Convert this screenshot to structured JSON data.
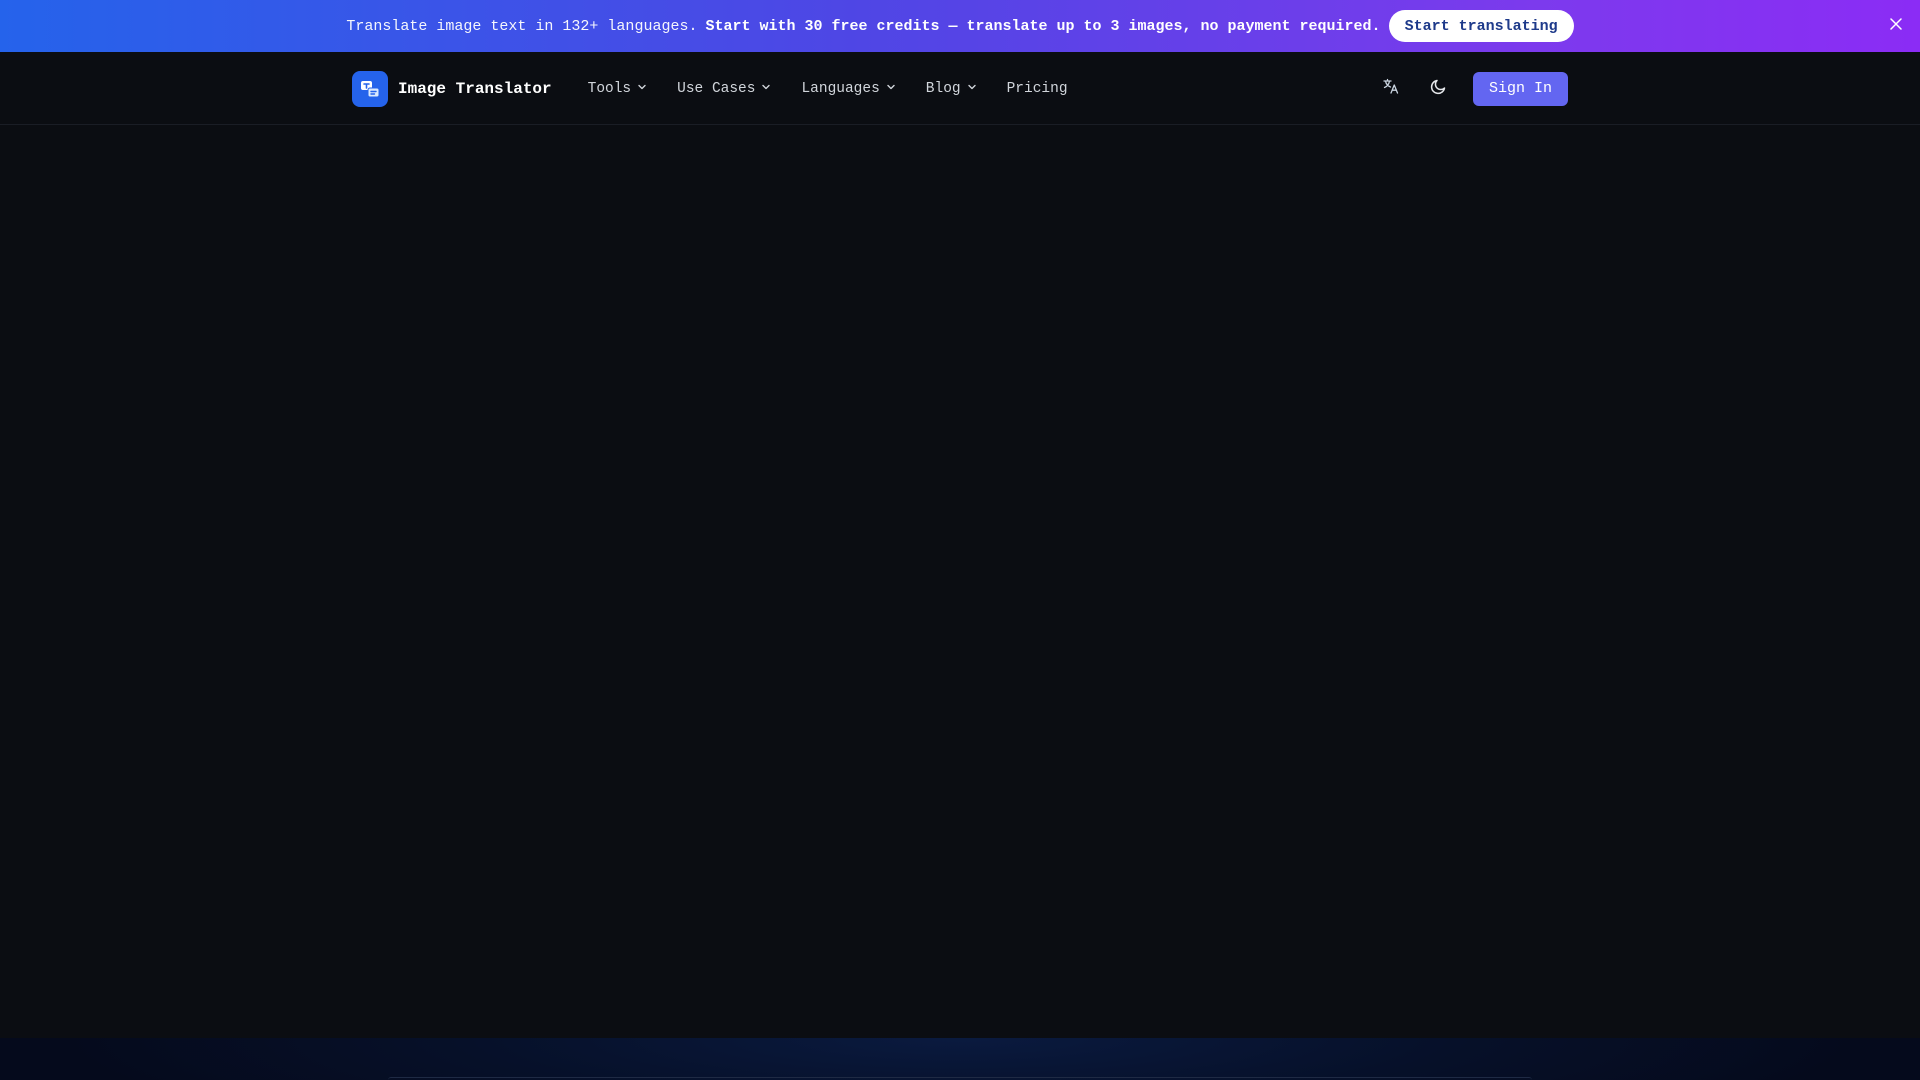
{
  "banner": {
    "text": "Translate image text in 132+ languages.",
    "bold_text": "Start with 30 free credits — translate up to 3 images, no payment required.",
    "cta_label": "Start translating",
    "close_icon": "close-icon"
  },
  "header": {
    "brand_name": "Image Translator",
    "logo_icon": "translate-logo-icon",
    "nav": [
      {
        "label": "Tools",
        "has_dropdown": true
      },
      {
        "label": "Use Cases",
        "has_dropdown": true
      },
      {
        "label": "Languages",
        "has_dropdown": true
      },
      {
        "label": "Blog",
        "has_dropdown": true
      },
      {
        "label": "Pricing",
        "has_dropdown": false
      }
    ],
    "language_icon": "language-icon",
    "theme_icon": "moon-icon",
    "signin_label": "Sign In"
  },
  "colors": {
    "banner_start": "#2563eb",
    "banner_end": "#8b2cf5",
    "background": "#0b0d12",
    "accent": "#6366f1",
    "logo_bg": "#2563eb"
  }
}
